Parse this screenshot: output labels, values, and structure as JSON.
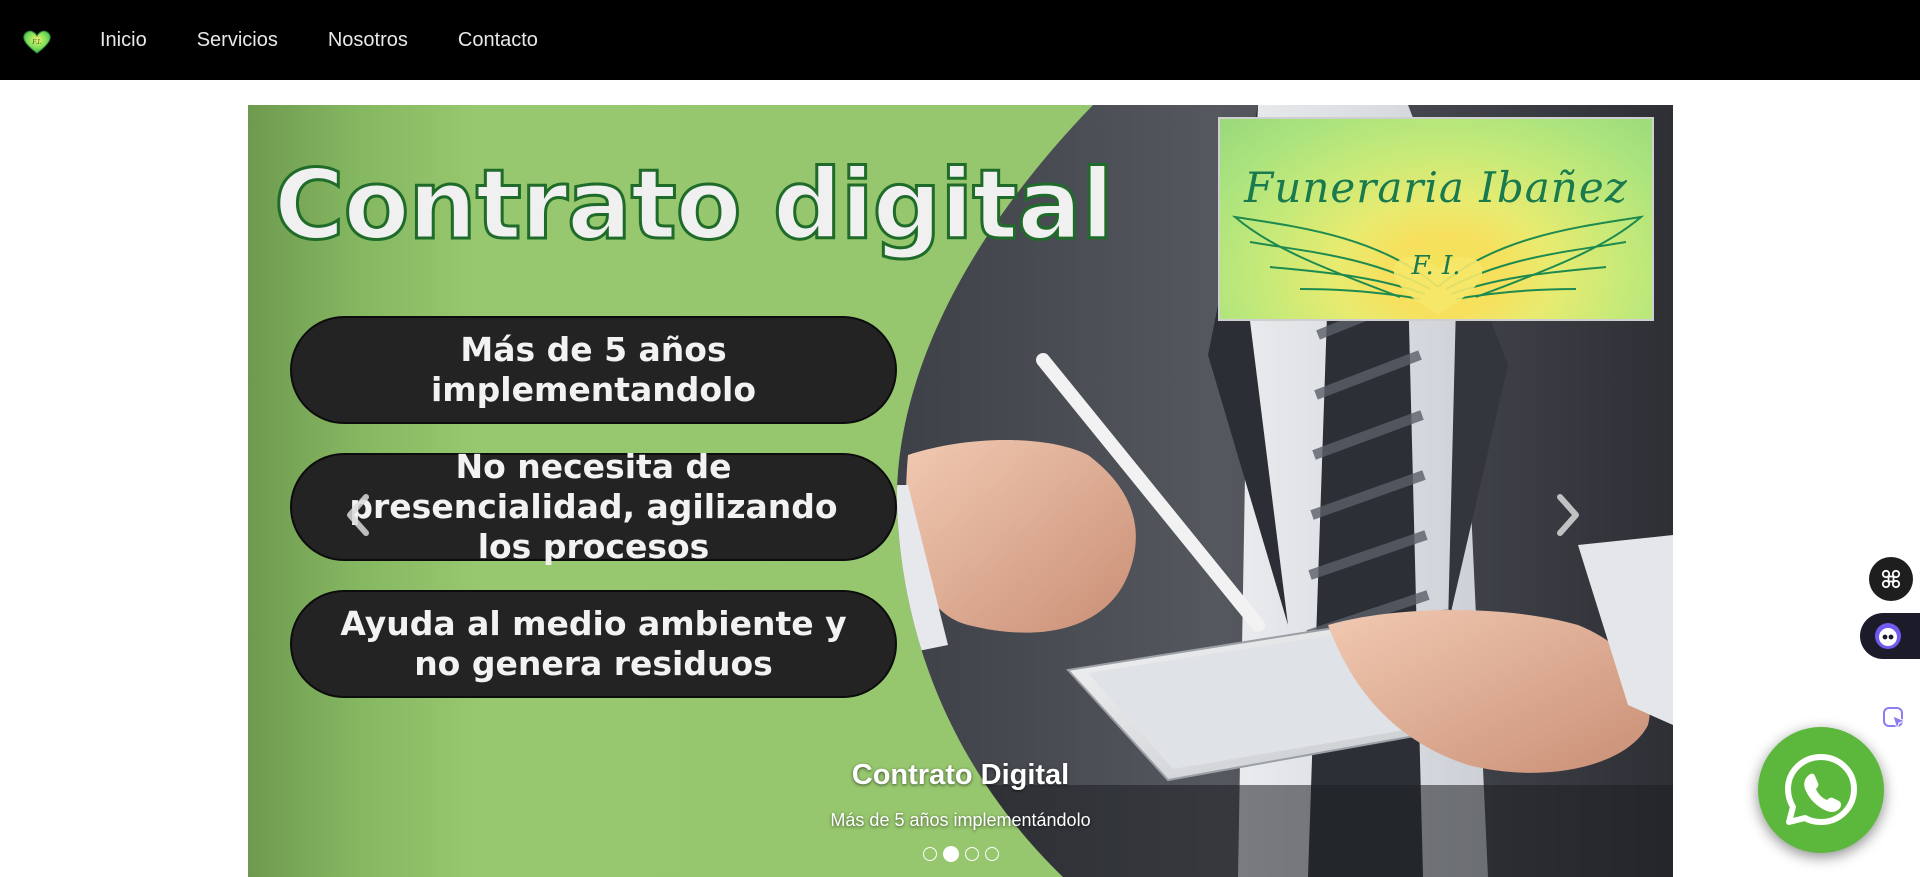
{
  "nav": {
    "brand_icon": "heart-logo-icon",
    "links": [
      "Inicio",
      "Servicios",
      "Nosotros",
      "Contacto"
    ]
  },
  "slide": {
    "headline": "Contrato digital",
    "pills": [
      "Más de 5 años implementandolo",
      "No necesita de presencialidad, agilizando los procesos",
      "Ayuda al medio ambiente y no genera residuos"
    ],
    "logo_text": "Funeraria Ibañez",
    "logo_initials": "F. I.",
    "caption_title": "Contrato Digital",
    "caption_subtitle": "Más de 5 años implementándolo",
    "indicator_count": 4,
    "active_indicator": 1,
    "prev_icon": "chevron-left-icon",
    "next_icon": "chevron-right-icon"
  },
  "widgets": {
    "apps_icon": "command-icon",
    "bot_icon": "bot-face-icon",
    "cursor_icon": "cursor-select-icon",
    "whatsapp_icon": "whatsapp-icon"
  },
  "colors": {
    "nav_bg": "#000000",
    "slide_green": "#96c66d",
    "pill_bg": "#232323",
    "whatsapp_green": "#5cb83c",
    "logo_green": "#1a7a4e"
  }
}
